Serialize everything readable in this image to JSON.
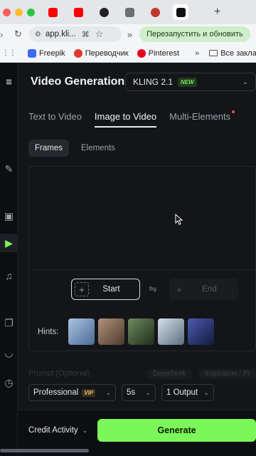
{
  "browser": {
    "tabs": [
      {
        "icon": "youtube-icon",
        "color": "#ff0000"
      },
      {
        "icon": "youtube-icon",
        "color": "#ff0000"
      },
      {
        "icon": "p-icon",
        "color": "#222222"
      },
      {
        "icon": "raccoon-icon",
        "color": "#555555"
      },
      {
        "icon": "app-icon",
        "color": "#c0392b"
      },
      {
        "icon": "kling-icon",
        "color": "#111111"
      }
    ],
    "new_tab": "+",
    "url": "app.kli...",
    "restart_button": "Перезапустить и обновить",
    "bookmarks": [
      {
        "label": "Freepik",
        "color": "#3b6cf6"
      },
      {
        "label": "Переводчик",
        "color": "#e0392b"
      },
      {
        "label": "Pinterest",
        "color": "#e60023"
      }
    ],
    "bookmarks_more": "»",
    "all_bookmarks": "Все закладки"
  },
  "header": {
    "title": "Video Generation",
    "model": "KLING 2.1",
    "model_badge": "NEW"
  },
  "tabs": [
    {
      "label": "Text to Video",
      "active": false
    },
    {
      "label": "Image to Video",
      "active": true
    },
    {
      "label": "Multi-Elements",
      "active": false
    }
  ],
  "subtabs": [
    {
      "label": "Frames",
      "active": true
    },
    {
      "label": "Elements",
      "active": false
    }
  ],
  "frames": {
    "start_label": "Start",
    "end_label": "End"
  },
  "hints": {
    "label": "Hints:",
    "thumbnails": [
      "#6f8fb8",
      "#8a6b52",
      "#3f5a3a",
      "#a7b6c4",
      "#2c3a7a"
    ]
  },
  "faded_row": {
    "left": "Prompt (Optional)",
    "pill1": "DeepSeek",
    "pill2": "Inspiration / Pr"
  },
  "settings": {
    "mode": "Professional",
    "mode_badge": "VIP",
    "duration": "5s",
    "outputs": "1 Output"
  },
  "footer": {
    "credit": "Credit Activity",
    "generate": "Generate"
  },
  "colors": {
    "accent": "#7cf75a",
    "panel": "#141519",
    "background": "#0d0e11"
  }
}
